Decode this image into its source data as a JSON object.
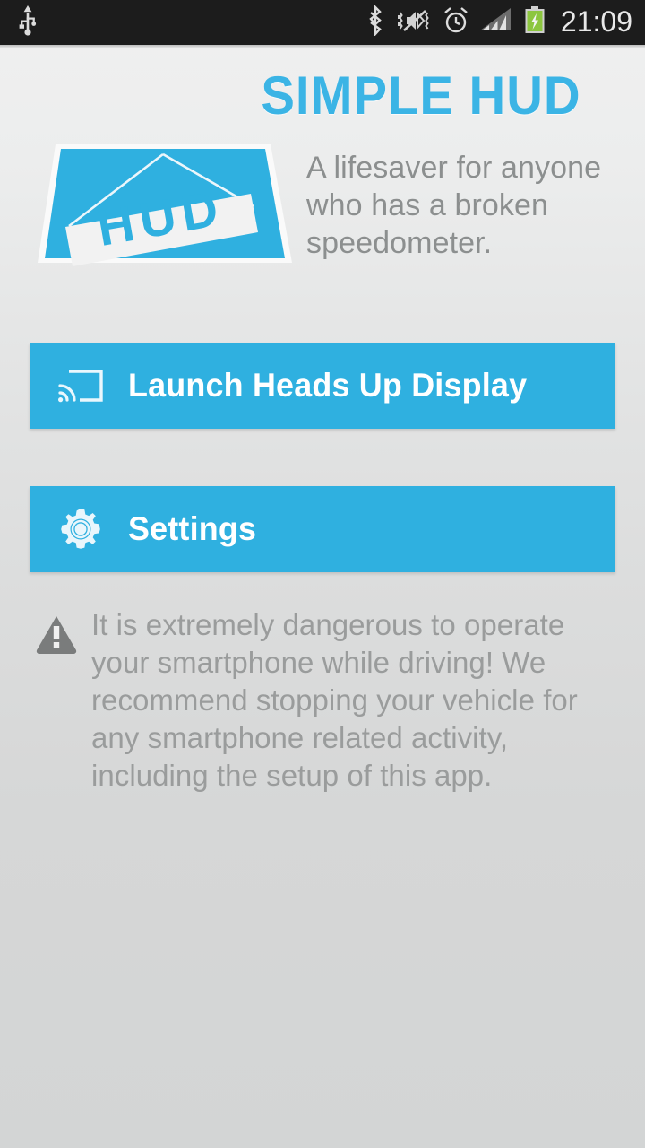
{
  "status_bar": {
    "left_icons": [
      {
        "name": "usb-icon",
        "label": "USB connected"
      }
    ],
    "right_icons": [
      {
        "name": "bluetooth-icon",
        "label": "Bluetooth"
      },
      {
        "name": "sound-muted-vibrate-icon",
        "label": "Silent / vibrate"
      },
      {
        "name": "alarm-clock-icon",
        "label": "Alarm set"
      },
      {
        "name": "cellular-signal-icon",
        "label": "Cellular signal"
      },
      {
        "name": "battery-charging-icon",
        "label": "Battery charging"
      }
    ],
    "clock": "21:09",
    "background_color": "#1c1c1c",
    "icon_color": "#d9d9d9",
    "battery_color": "#8cc63f"
  },
  "header": {
    "app_title": "SIMPLE HUD",
    "title_color": "#3bb4e5",
    "logo": {
      "name": "hud-windshield-logo",
      "banner_text": "HUD",
      "shape_color": "#2fb0e0",
      "banner_color": "#f2f2f2"
    },
    "tagline": "A lifesaver for anyone who has a broken speedometer."
  },
  "buttons": [
    {
      "id": "launch",
      "icon": "cast-screen-icon",
      "label": "Launch Heads Up Display",
      "color": "#2fb0e0",
      "text_color": "#ffffff"
    },
    {
      "id": "settings",
      "icon": "gear-icon",
      "label": "Settings",
      "color": "#2fb0e0",
      "text_color": "#ffffff"
    }
  ],
  "warning": {
    "icon": "warning-triangle-icon",
    "icon_color": "#7a7c7c",
    "text": "It is extremely dangerous to operate your smartphone while driving! We recommend stopping your vehicle for any smartphone related activity, including the setup of this app.",
    "text_color": "#9a9c9c"
  },
  "theme": {
    "background_top": "#f0f0f0",
    "background_bottom": "#d3d5d5",
    "accent": "#2fb0e0"
  }
}
